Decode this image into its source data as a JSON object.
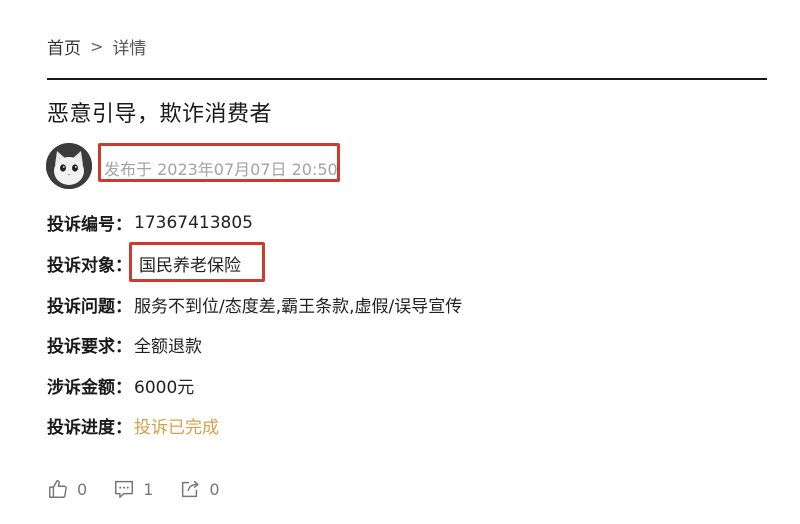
{
  "breadcrumb": {
    "home": "首页",
    "separator": ">",
    "current": "详情"
  },
  "post": {
    "title": "恶意引导，欺诈消费者",
    "avatar_icon": "cat-avatar-icon",
    "published": "发布于 2023年07月07日 20:50"
  },
  "fields": [
    {
      "label": "投诉编号：",
      "value": "17367413805"
    },
    {
      "label": "投诉对象：",
      "value": "国民养老保险"
    },
    {
      "label": "投诉问题：",
      "value": "服务不到位/态度差,霸王条款,虚假/误导宣传"
    },
    {
      "label": "投诉要求：",
      "value": "全额退款"
    },
    {
      "label": "涉诉金额：",
      "value": "6000元"
    },
    {
      "label": "投诉进度：",
      "value": "投诉已完成"
    }
  ],
  "actions": {
    "like": {
      "icon": "thumbs-up-icon",
      "count": "0"
    },
    "comment": {
      "icon": "comment-icon",
      "count": "1"
    },
    "share": {
      "icon": "share-icon",
      "count": "0"
    }
  },
  "colors": {
    "highlight_border": "#cc3b2f",
    "status_done": "#d4a04b",
    "meta_text": "#a3a3a3"
  }
}
